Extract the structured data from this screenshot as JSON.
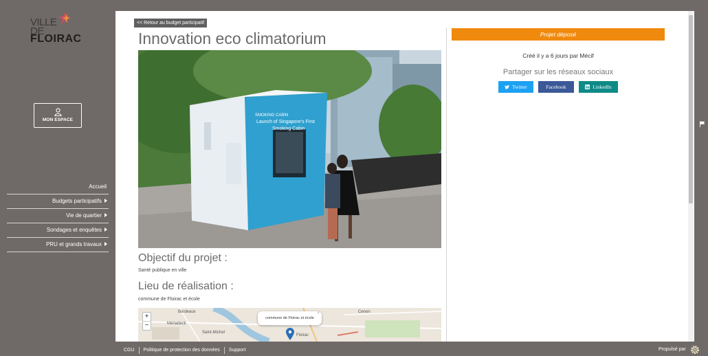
{
  "brand": {
    "logo_line1": "VILLE",
    "logo_line2": "DE",
    "logo_line3": "FLOIRAC"
  },
  "account": {
    "label": "MON ESPACE",
    "icon": "user-icon"
  },
  "nav": {
    "items": [
      {
        "label": "Accueil",
        "has_caret": false
      },
      {
        "label": "Budgets participatifs",
        "has_caret": true
      },
      {
        "label": "Vie de quartier",
        "has_caret": true
      },
      {
        "label": "Sondages et enquêtes",
        "has_caret": true
      },
      {
        "label": "PRU et grands travaux",
        "has_caret": true
      }
    ]
  },
  "project": {
    "back_label": "<< Retour au budget participatif",
    "title": "Innovation eco climatorium",
    "objective_title": "Objectif du projet :",
    "objective_text": "Santé publique en ville",
    "location_title": "Lieu de réalisation :",
    "location_text": "commune de Floirac et école",
    "photo_sign": {
      "line1": "SMOKING CABIN",
      "line2": "Launch of Singapore's First",
      "line3": "Smoking Cabin"
    }
  },
  "map": {
    "popup_text": "commune de Floirac et école",
    "zoom_in": "+",
    "zoom_out": "−",
    "labels": [
      "Bordeaux",
      "Saint-Michel",
      "Floirac",
      "Mériadeck",
      "Cenon"
    ]
  },
  "sidebar_right": {
    "status": "Projet déposé",
    "status_color": "#f08a0e",
    "created": "Créé il y a 6 jours par Mécif",
    "share_title": "Partager sur les réseaux sociaux",
    "twitter": "Twitter",
    "facebook": "Facebook",
    "linkedin": "LinkedIn"
  },
  "footer": {
    "links": [
      "CGU",
      "Politique de protection des données",
      "Support"
    ],
    "powered": "Propulsé par"
  }
}
